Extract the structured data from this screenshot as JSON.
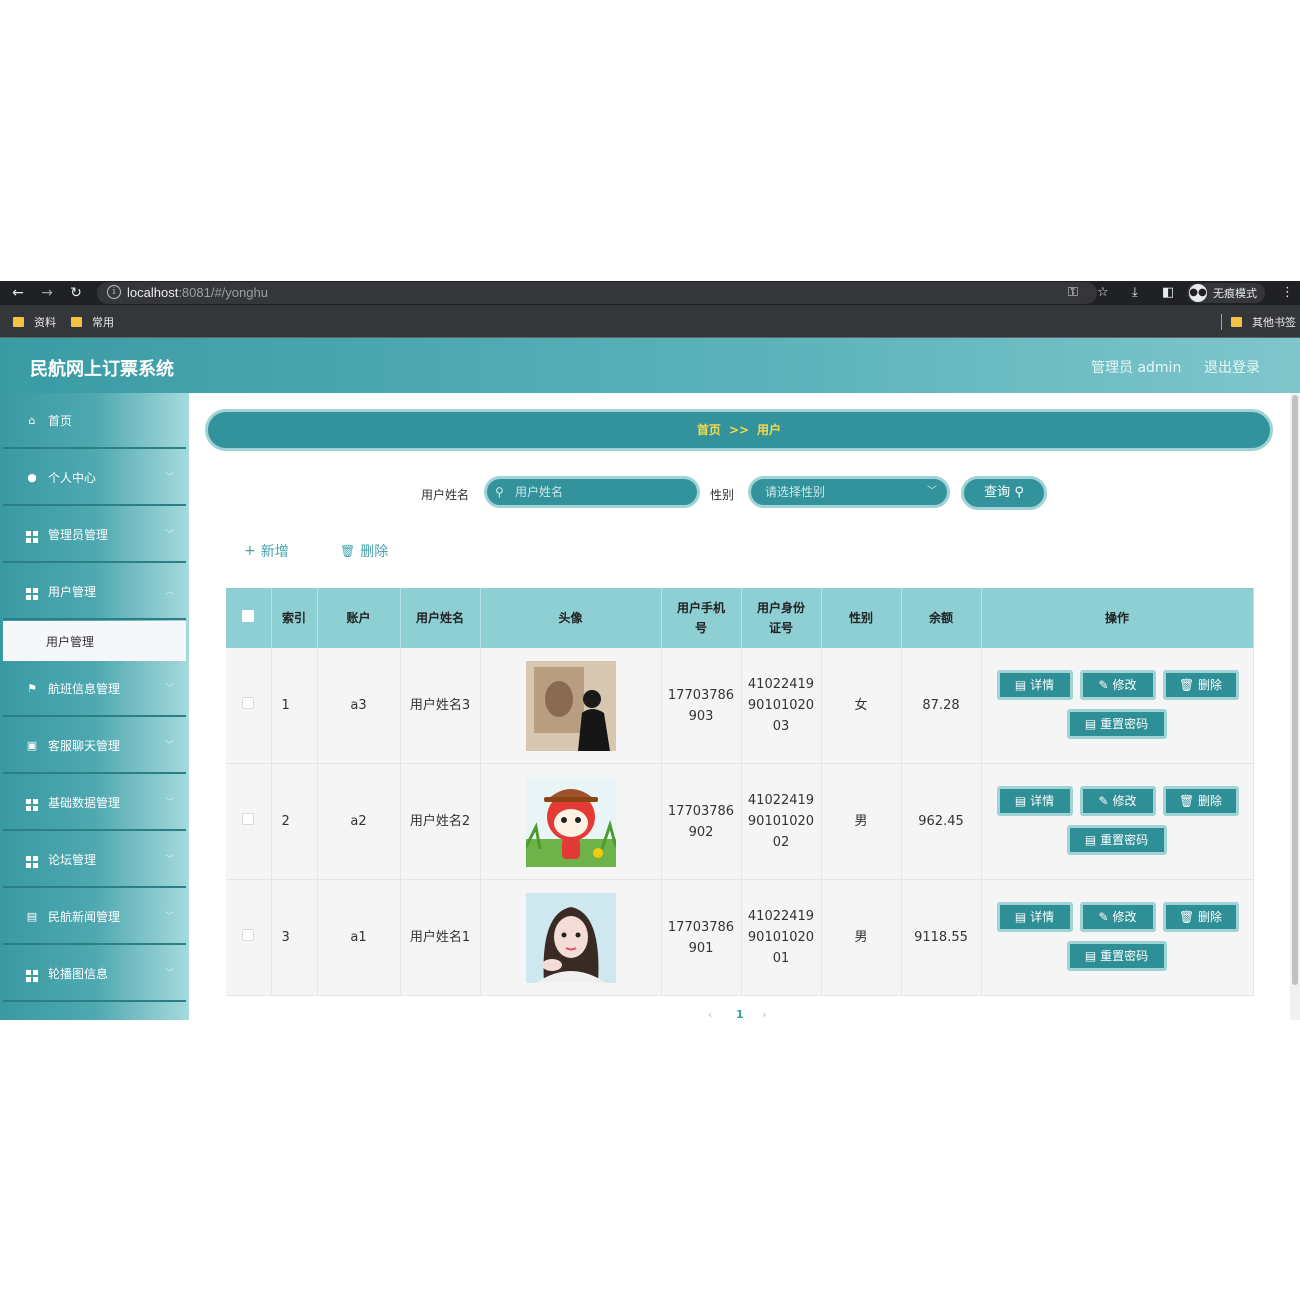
{
  "browser": {
    "url_host": "localhost",
    "url_rest": ":8081/#/yonghu",
    "incognito_label": "无痕模式",
    "bookmarks": [
      "资料",
      "常用"
    ],
    "other_bookmarks": "其他书签"
  },
  "app": {
    "title": "民航网上订票系统",
    "user_label": "管理员 admin",
    "logout_label": "退出登录"
  },
  "sidebar": {
    "items": [
      {
        "label": "首页",
        "icon": "home-icon"
      },
      {
        "label": "个人中心",
        "icon": "user-icon"
      },
      {
        "label": "管理员管理",
        "icon": "grid-icon"
      },
      {
        "label": "用户管理",
        "icon": "grid-icon"
      },
      {
        "label": "航班信息管理",
        "icon": "flag-icon"
      },
      {
        "label": "客服聊天管理",
        "icon": "clipboard-icon"
      },
      {
        "label": "基础数据管理",
        "icon": "grid-icon"
      },
      {
        "label": "论坛管理",
        "icon": "grid-icon"
      },
      {
        "label": "民航新闻管理",
        "icon": "document-icon"
      },
      {
        "label": "轮播图信息",
        "icon": "grid-icon"
      }
    ],
    "active_sub": "用户管理"
  },
  "breadcrumb": {
    "home": "首页",
    "sep": ">>",
    "current": "用户"
  },
  "search": {
    "name_label": "用户姓名",
    "name_placeholder": "用户姓名",
    "gender_label": "性别",
    "gender_placeholder": "请选择性别",
    "query_label": "查询"
  },
  "actions": {
    "add": "新增",
    "delete": "删除"
  },
  "table": {
    "headers": [
      "索引",
      "账户",
      "用户姓名",
      "头像",
      "用户手机号",
      "用户身份证号",
      "性别",
      "余额",
      "操作"
    ],
    "rows": [
      {
        "index": "1",
        "account": "a3",
        "name": "用户姓名3",
        "phone": [
          "17703786",
          "903"
        ],
        "idcard": [
          "41022419",
          "90101020",
          "03"
        ],
        "gender": "女",
        "balance": "87.28"
      },
      {
        "index": "2",
        "account": "a2",
        "name": "用户姓名2",
        "phone": [
          "17703786",
          "902"
        ],
        "idcard": [
          "41022419",
          "90101020",
          "02"
        ],
        "gender": "男",
        "balance": "962.45"
      },
      {
        "index": "3",
        "account": "a1",
        "name": "用户姓名1",
        "phone": [
          "17703786",
          "901"
        ],
        "idcard": [
          "41022419",
          "90101020",
          "01"
        ],
        "gender": "男",
        "balance": "9118.55"
      }
    ],
    "row_buttons": {
      "detail": "详情",
      "edit": "修改",
      "delete": "删除",
      "reset": "重置密码"
    }
  },
  "pagination": {
    "prev": "‹",
    "current": "1",
    "next": "›"
  },
  "colors": {
    "accent": "#33939c",
    "breadcrumb_text": "#f6d94a",
    "table_header": "#8dcfd3"
  }
}
